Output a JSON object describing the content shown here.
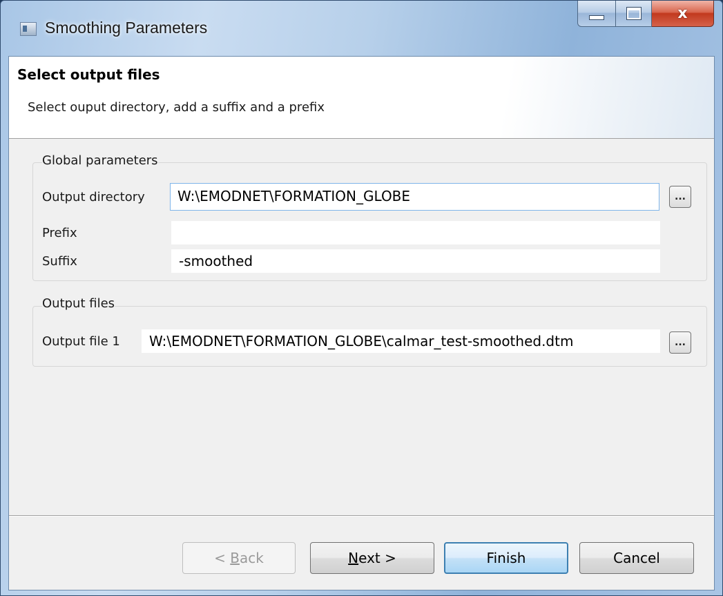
{
  "window": {
    "title": "Smoothing Parameters",
    "caption_buttons": {
      "minimize_icon": "minimize-icon",
      "maximize_icon": "maximize-icon",
      "close_icon": "close-icon",
      "close_glyph": "x"
    }
  },
  "header": {
    "title": "Select output files",
    "description": "Select ouput directory, add a suffix and a prefix"
  },
  "global_parameters": {
    "title": "Global parameters",
    "output_directory_label": "Output directory",
    "output_directory_value": "W:\\EMODNET\\FORMATION_GLOBE",
    "prefix_label": "Prefix",
    "prefix_value": "",
    "suffix_label": "Suffix",
    "suffix_value": "-smoothed",
    "browse_label": "..."
  },
  "output_files": {
    "title": "Output files",
    "file1_label": "Output file 1",
    "file1_value": "W:\\EMODNET\\FORMATION_GLOBE\\calmar_test-smoothed.dtm",
    "browse_label": "..."
  },
  "buttons": {
    "back_prefix": "< ",
    "back_mnemonic": "B",
    "back_rest": "ack",
    "next_mnemonic": "N",
    "next_rest": "ext >",
    "finish": "Finish",
    "cancel": "Cancel"
  },
  "colors": {
    "accent": "#3c7fb1",
    "disabled_text": "#9a9a9a"
  }
}
